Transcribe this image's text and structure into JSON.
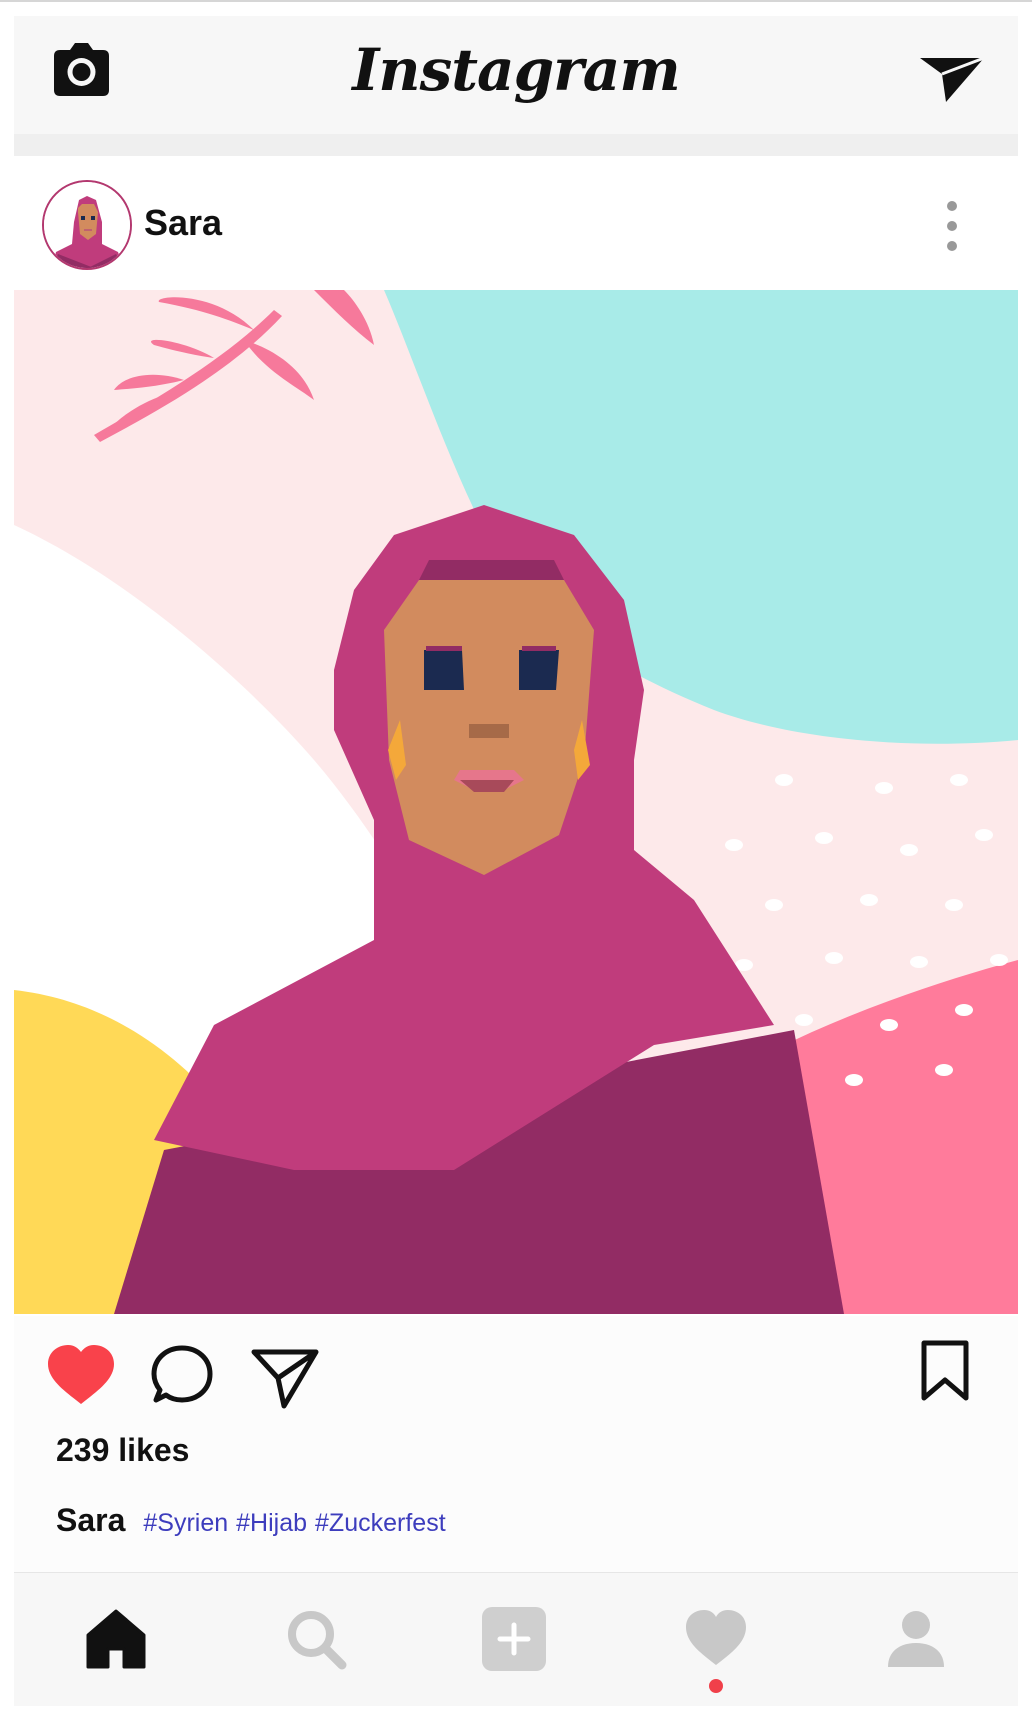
{
  "app": {
    "title": "Instagram"
  },
  "post": {
    "username": "Sara",
    "likes_text": "239 likes",
    "caption_user": "Sara",
    "hashtags": [
      "#Syrien",
      "#Hijab",
      "#Zuckerfest"
    ],
    "liked": true
  },
  "icons": {
    "camera": "camera-icon",
    "direct": "paper-plane-icon",
    "more": "vertical-dots-icon",
    "like": "heart-icon",
    "comment": "speech-bubble-icon",
    "share": "paper-plane-icon",
    "save": "bookmark-icon",
    "home": "home-icon",
    "search": "search-icon",
    "add": "plus-square-icon",
    "activity": "heart-icon",
    "profile": "person-icon"
  },
  "colors": {
    "like_red": "#f9424b",
    "hashtag_blue": "#3d3dbd",
    "hijab_magenta": "#c03c7c",
    "robe_plum": "#922c64",
    "skin": "#d28b5e",
    "teal": "#a8ebe8",
    "pink_bg": "#fde9ea",
    "salmon": "#ff7b9b",
    "yellow": "#ffd957",
    "notification_dot": "#f0404a"
  }
}
